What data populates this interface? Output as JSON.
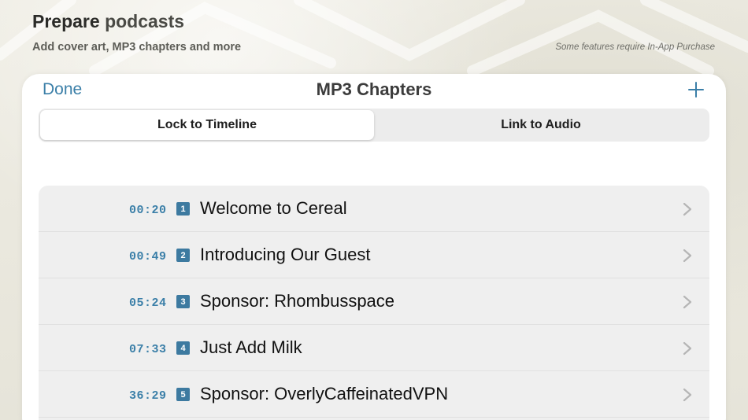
{
  "promo": {
    "title_bold": "Prepare",
    "title_rest": "podcasts",
    "subtitle": "Add cover art, MP3 chapters and more",
    "note": "Some features require In-App Purchase"
  },
  "nav": {
    "done_label": "Done",
    "title": "MP3 Chapters",
    "add_icon": "plus-icon"
  },
  "segments": [
    {
      "label": "Lock to Timeline",
      "selected": true
    },
    {
      "label": "Link to Audio",
      "selected": false
    }
  ],
  "chapters": [
    {
      "time": "00:20",
      "number": "1",
      "title": "Welcome to Cereal"
    },
    {
      "time": "00:49",
      "number": "2",
      "title": "Introducing Our Guest"
    },
    {
      "time": "05:24",
      "number": "3",
      "title": "Sponsor: Rhombusspace"
    },
    {
      "time": "07:33",
      "number": "4",
      "title": "Just Add Milk"
    },
    {
      "time": "36:29",
      "number": "5",
      "title": "Sponsor: OverlyCaffeinatedVPN"
    }
  ],
  "colors": {
    "accent": "#3b7fa8",
    "badge": "#3d7aa0"
  }
}
